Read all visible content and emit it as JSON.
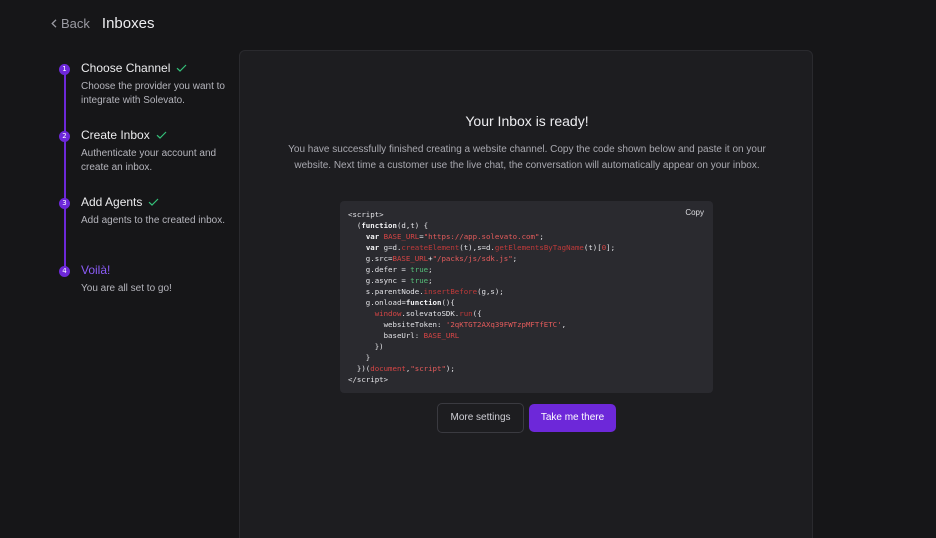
{
  "header": {
    "back_label": "Back",
    "title": "Inboxes"
  },
  "steps": [
    {
      "number": "1",
      "title": "Choose Channel",
      "description": "Choose the provider you want to integrate with Solevato.",
      "completed": true
    },
    {
      "number": "2",
      "title": "Create Inbox",
      "description": "Authenticate your account and create an inbox.",
      "completed": true
    },
    {
      "number": "3",
      "title": "Add Agents",
      "description": "Add agents to the created inbox.",
      "completed": true
    },
    {
      "number": "4",
      "title": "Voilà!",
      "description": "You are all set to go!",
      "completed": false
    }
  ],
  "card": {
    "title": "Your Inbox is ready!",
    "description": "You have successfully finished creating a website channel. Copy the code shown below and paste it on your website. Next time a customer use the live chat, the conversation will automatically appear on your inbox.",
    "copy_label": "Copy",
    "base_url": "https://app.solevato.com",
    "sdk_path": "/packs/js/sdk.js",
    "website_token": "2qKTGT2AXq39FWTzpMFTfETC",
    "more_settings_label": "More settings",
    "take_me_there_label": "Take me there"
  },
  "colors": {
    "accent": "#6d28d9",
    "background": "#161618",
    "card": "#1d1d20",
    "code_background": "#2a2a2f"
  }
}
